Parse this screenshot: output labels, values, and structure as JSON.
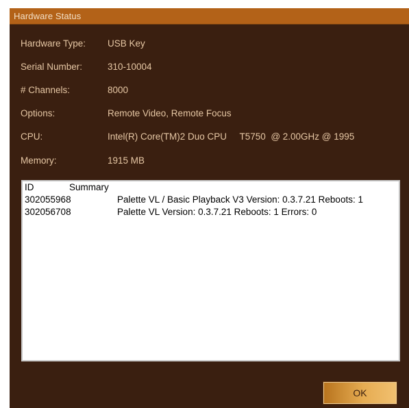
{
  "window": {
    "title": "Hardware Status"
  },
  "hardware": {
    "type_label": "Hardware Type:",
    "type_value": "USB Key",
    "serial_label": "Serial Number:",
    "serial_value": "310-10004",
    "channels_label": "# Channels:",
    "channels_value": "8000",
    "options_label": "Options:",
    "options_value": "Remote Video, Remote Focus",
    "cpu_label": "CPU:",
    "cpu_value": "Intel(R) Core(TM)2 Duo CPU     T5750  @ 2.00GHz @ 1995",
    "memory_label": "Memory:",
    "memory_value": "1915 MB"
  },
  "list": {
    "headers": [
      "ID",
      "Summary"
    ],
    "rows": [
      {
        "id": "302055968",
        "summary": "Palette VL / Basic Playback V3 Version: 0.3.7.21 Reboots: 1"
      },
      {
        "id": "302056708",
        "summary": "Palette VL Version: 0.3.7.21 Reboots: 1 Errors: 0"
      }
    ]
  },
  "buttons": {
    "ok_label": "OK"
  },
  "colors": {
    "window_background": "#3a1f10",
    "title_bar": "#b36218",
    "label_text": "#e6c7a4",
    "list_background": "#ffffff"
  }
}
